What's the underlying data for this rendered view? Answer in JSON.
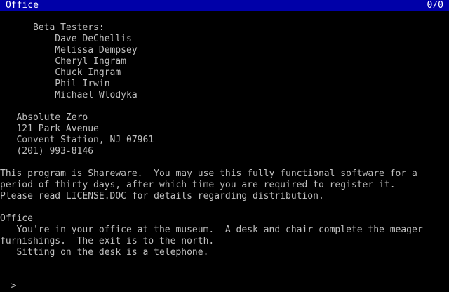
{
  "status_bar": {
    "room": "Office",
    "score": "0/0"
  },
  "credits": {
    "heading": "      Beta Testers:",
    "testers": [
      "          Dave DeChellis",
      "          Melissa Dempsey",
      "          Cheryl Ingram",
      "          Chuck Ingram",
      "          Phil Irwin",
      "          Michael Wlodyka"
    ]
  },
  "address": [
    "   Absolute Zero",
    "   121 Park Avenue",
    "   Convent Station, NJ 07961",
    "   (201) 993-8146"
  ],
  "shareware_notice": [
    "This program is Shareware.  You may use this fully functional software for a",
    "period of thirty days, after which time you are required to register it.",
    "Please read LICENSE.DOC for details regarding distribution."
  ],
  "room": {
    "title": "Office",
    "description": [
      "   You're in your office at the museum.  A desk and chair complete the meager",
      "furnishings.  The exit is to the north.",
      "   Sitting on the desk is a telephone."
    ]
  },
  "prompt": {
    "symbol": ">",
    "value": ""
  },
  "colors": {
    "background": "#000000",
    "text": "#c0c0c0",
    "status_bar_bg": "#0000a8",
    "status_bar_text": "#ffffff"
  }
}
